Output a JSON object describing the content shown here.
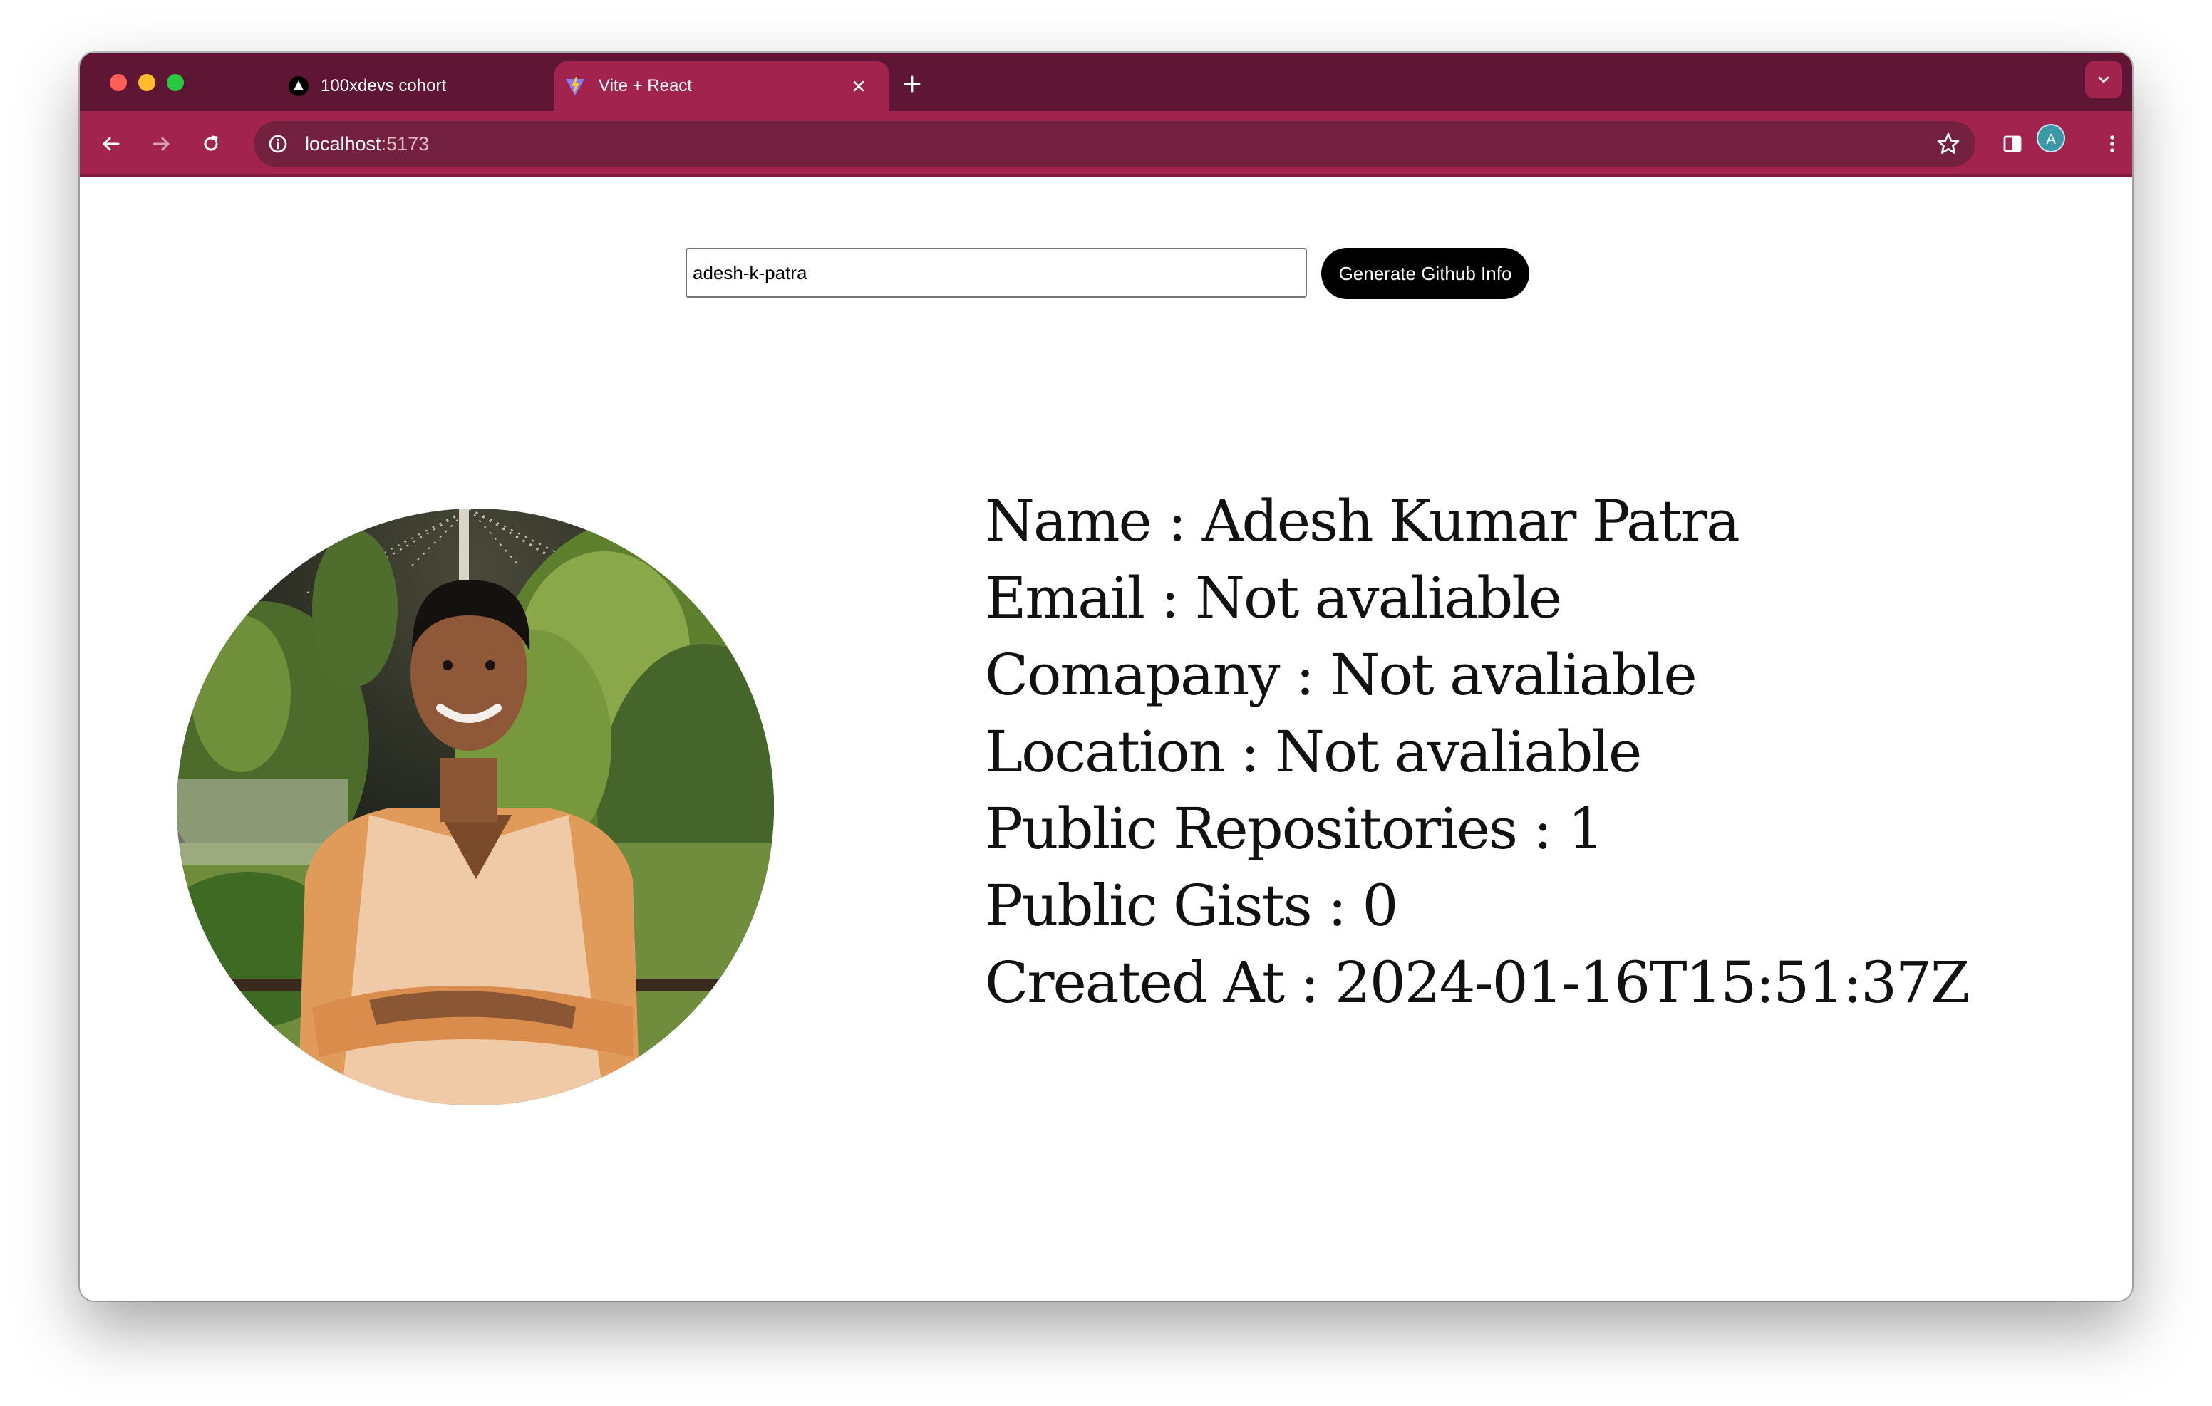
{
  "browser": {
    "tabs": [
      {
        "title": "100xdevs cohort",
        "icon": "triangle-logo-icon",
        "active": false
      },
      {
        "title": "Vite + React",
        "icon": "vite-logo-icon",
        "active": true
      }
    ],
    "address": {
      "host": "localhost",
      "port": ":5173"
    },
    "profile_initial": "A",
    "colors": {
      "tabstrip": "#5f1634",
      "toolbar": "#a2244e",
      "omnibox": "#74203f"
    }
  },
  "form": {
    "username_value": "adesh-k-patra",
    "button_label": "Generate Github Info"
  },
  "profile": {
    "photo": "profile-photo",
    "name_line": "Name : Adesh Kumar Patra",
    "email_line": "Email : Not avaliable",
    "company_line": "Comapany : Not avaliable",
    "location_line": "Location : Not avaliable",
    "repos_line": "Public Repositories : 1",
    "gists_line": "Public Gists : 0",
    "created_line": "Created At : 2024-01-16T15:51:37Z"
  }
}
